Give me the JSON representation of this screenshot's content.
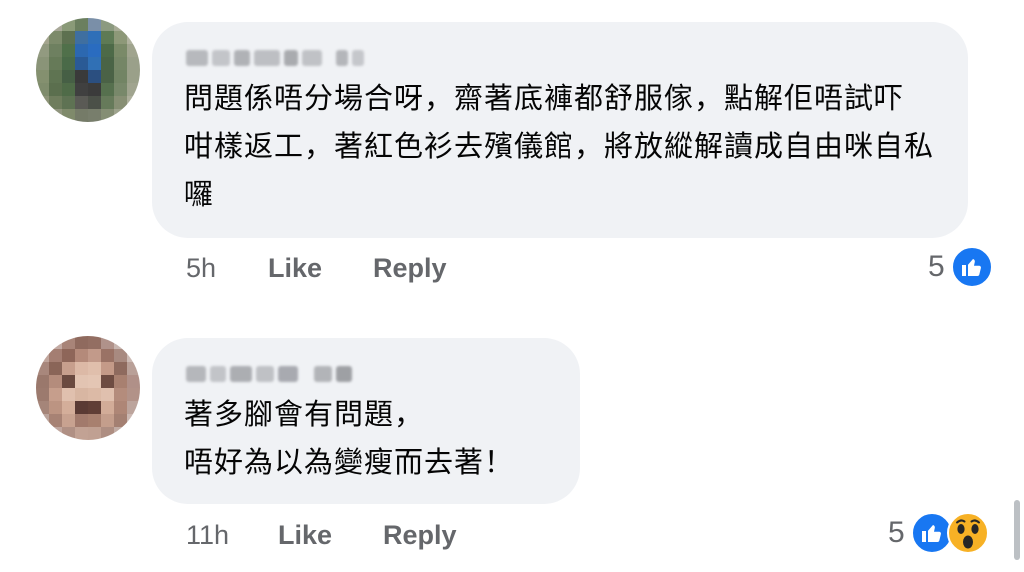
{
  "comments": [
    {
      "author": "Oldman Li",
      "body_lines": [
        "問題係唔分場合呀，齋著底褲都舒服傢，點解佢唔試吓",
        "咁樣返工，著紅色衫去殯儀館，將放縱解讀成自由咪自私",
        "囉"
      ],
      "time": "5h",
      "like_label": "Like",
      "reply_label": "Reply",
      "reaction_count": "5",
      "reactions": [
        "like-icon"
      ]
    },
    {
      "author": "Cherry CN",
      "body_lines": [
        "著多腳會有問題，",
        "唔好為以為變瘦而去著！"
      ],
      "time": "11h",
      "like_label": "Like",
      "reply_label": "Reply",
      "reaction_count": "5",
      "reactions": [
        "like-icon",
        "wow-icon"
      ]
    }
  ],
  "colors": {
    "bubble_bg": "#f0f2f5",
    "meta_text": "#65676b",
    "like_blue": "#1877f2",
    "wow_yellow": "#f7b125"
  }
}
